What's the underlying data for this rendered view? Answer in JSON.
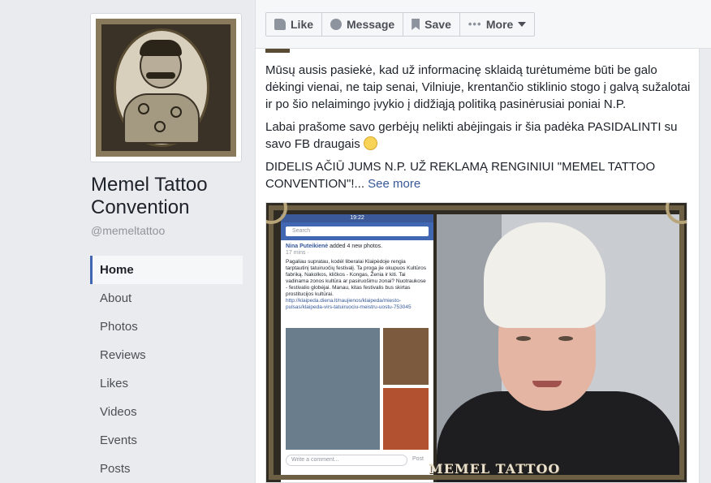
{
  "page": {
    "name": "Memel Tattoo Convention",
    "handle": "@memeltattoo"
  },
  "nav": {
    "items": [
      {
        "label": "Home",
        "active": true
      },
      {
        "label": "About"
      },
      {
        "label": "Photos"
      },
      {
        "label": "Reviews"
      },
      {
        "label": "Likes"
      },
      {
        "label": "Videos"
      },
      {
        "label": "Events"
      },
      {
        "label": "Posts"
      }
    ]
  },
  "toolbar": {
    "like_label": "Like",
    "message_label": "Message",
    "save_label": "Save",
    "more_label": "More"
  },
  "post": {
    "paragraph1": "Mūsų ausis pasiekė, kad už informacinę sklaidą turėtumėme būti be galo dėkingi vienai, ne taip senai, Vilniuje, krentančio stiklinio stogo į galvą sužalotai ir po šio nelaimingo įvykio į didžiąją politiką pasinėrusiai poniai N.P.",
    "paragraph2": "Labai prašome savo gerbėjų nelikti abėjingais ir šia padėka PASIDALINTI su savo FB draugais",
    "paragraph3": "DIDELIS AČIŪ JUMS N.P. UŽ REKLAMĄ RENGINIUI \"MEMEL TATTOO CONVENTION\"!...",
    "see_more": "See more"
  },
  "photo": {
    "phone_time": "19:22",
    "phone_search": "Search",
    "shot_author": "Nina Puteikienė",
    "shot_action": "added 4 new photos.",
    "shot_meta": "17 mins · ",
    "shot_body": "Pagaliau supratau, kodėl liberalai Klaipėdoje rengia tarptautinį tatuiruočių festivalį. Ta proga jie okupuos Kultūros fabriką. Nakolkos, kličkos - Kongas, Ženia ir kiti. Tai vadinama zonos kultūra ar pasiruošimu zonai? Nuotraukose - festivalio globėjai. Manau, kitas festivalis bus skirtas prostitucijos kultūrai.",
    "shot_link": "http://klaipeda.diena.lt/naujienos/klaipeda/miesto-pulsas/klaipeda-virs-tatuiruociu-meistru-uostu-753045",
    "shot_comment": "Write a comment...",
    "shot_post": "Post",
    "logo_text": "MEMEL TATTOO"
  }
}
